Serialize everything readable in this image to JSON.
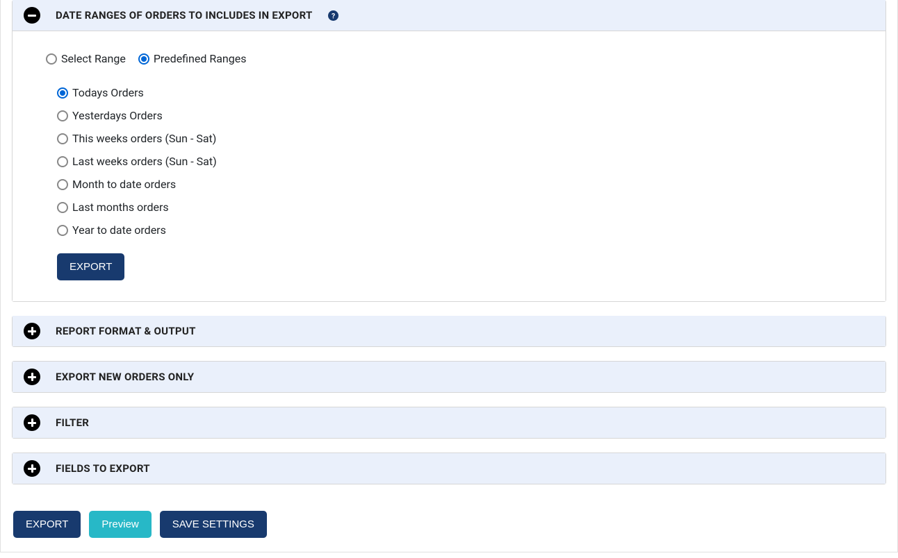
{
  "sections": {
    "date_ranges": {
      "title": "DATE RANGES OF ORDERS TO INCLUDES IN EXPORT",
      "mode_options": {
        "select_range": "Select Range",
        "predefined_ranges": "Predefined Ranges"
      },
      "predefined": {
        "todays": "Todays Orders",
        "yesterdays": "Yesterdays Orders",
        "this_week": "This weeks orders (Sun - Sat)",
        "last_week": "Last weeks orders (Sun - Sat)",
        "month_to_date": "Month to date orders",
        "last_month": "Last months orders",
        "year_to_date": "Year to date orders"
      },
      "export_button": "EXPORT"
    },
    "report_format": {
      "title": "REPORT FORMAT & OUTPUT"
    },
    "export_new_only": {
      "title": "EXPORT NEW ORDERS ONLY"
    },
    "filter": {
      "title": "FILTER"
    },
    "fields_to_export": {
      "title": "FIELDS TO EXPORT"
    }
  },
  "footer": {
    "export": "EXPORT",
    "preview": "Preview",
    "save_settings": "SAVE SETTINGS"
  }
}
